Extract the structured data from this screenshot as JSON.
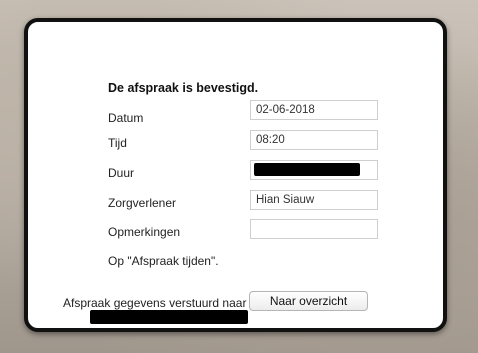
{
  "confirmation": {
    "heading": "De afspraak is bevestigd.",
    "fields": [
      {
        "label": "Datum",
        "value": "02-06-2018"
      },
      {
        "label": "Tijd",
        "value": "08:20"
      },
      {
        "label": "Duur",
        "value": ""
      },
      {
        "label": "Zorgverlener",
        "value": "Hian Siauw"
      },
      {
        "label": "Opmerkingen",
        "value": ""
      }
    ],
    "note": "Op \"Afspraak tijden\".",
    "sent_text": "Afspraak gegevens verstuurd naar",
    "overview_button": "Naar overzicht"
  }
}
